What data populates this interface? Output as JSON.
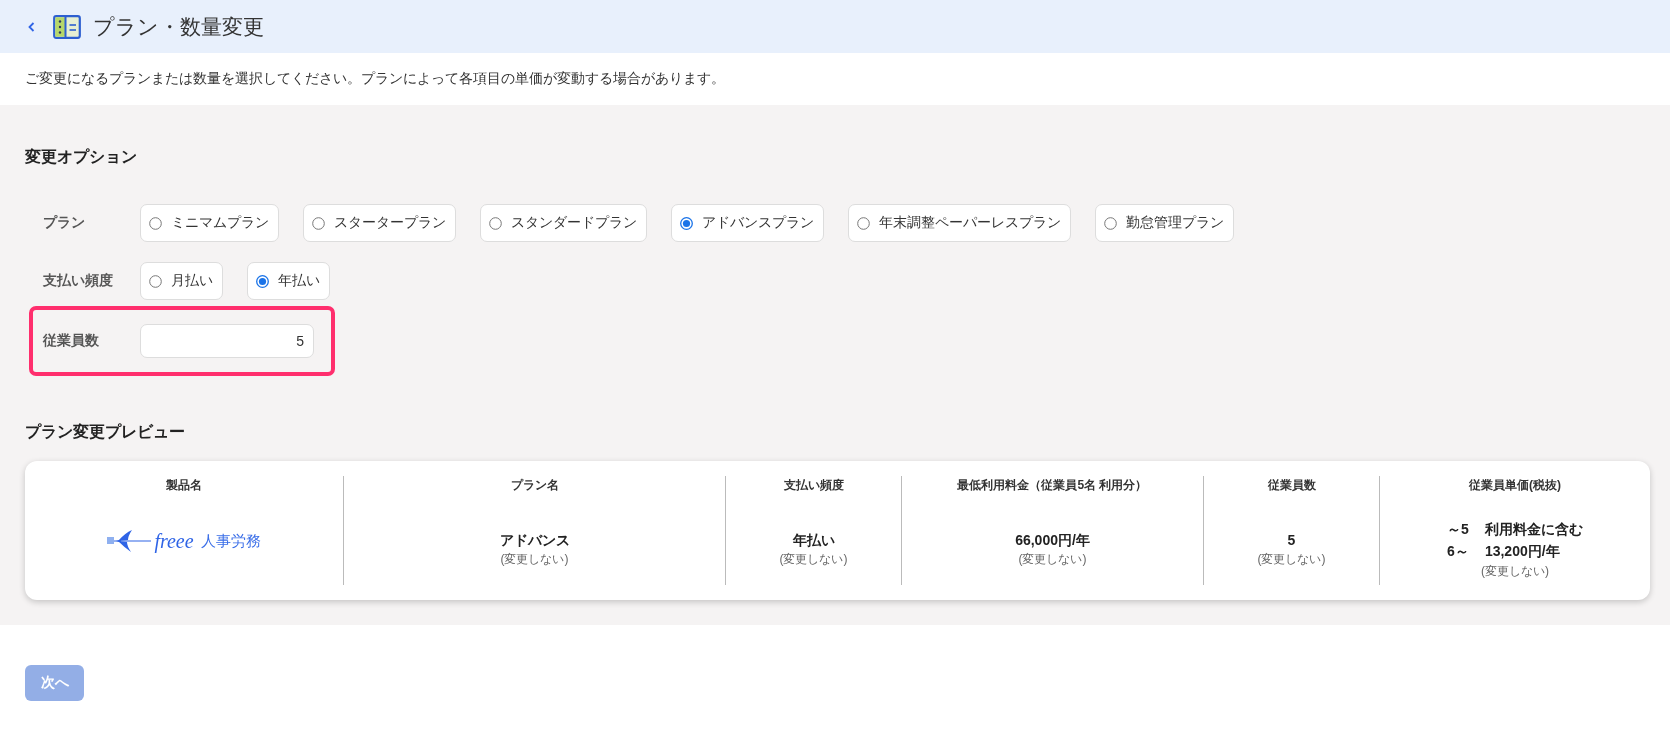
{
  "header": {
    "title": "プラン・数量変更"
  },
  "description": "ご変更になるプランまたは数量を選択してください。プランによって各項目の単価が変動する場合があります。",
  "options": {
    "title": "変更オプション",
    "rows": [
      {
        "kind": "radio",
        "label": "プラン",
        "items": [
          {
            "label": "ミニマムプラン",
            "selected": false
          },
          {
            "label": "スタータープラン",
            "selected": false
          },
          {
            "label": "スタンダードプラン",
            "selected": false
          },
          {
            "label": "アドバンスプラン",
            "selected": true
          },
          {
            "label": "年末調整ペーパーレスプラン",
            "selected": false
          },
          {
            "label": "勤怠管理プラン",
            "selected": false
          }
        ]
      },
      {
        "kind": "radio",
        "label": "支払い頻度",
        "items": [
          {
            "label": "月払い",
            "selected": false
          },
          {
            "label": "年払い",
            "selected": true
          }
        ]
      },
      {
        "kind": "number",
        "label": "従業員数",
        "value": "5",
        "highlighted": true
      }
    ]
  },
  "preview": {
    "title": "プラン変更プレビュー",
    "columns": [
      {
        "kind": "logo",
        "header": "製品名",
        "wordmark": "freee",
        "product": "人事労務"
      },
      {
        "kind": "value",
        "header": "プラン名",
        "value": "アドバンス",
        "note": "(変更しない)"
      },
      {
        "kind": "value",
        "header": "支払い頻度",
        "value": "年払い",
        "note": "(変更しない)"
      },
      {
        "kind": "value",
        "header": "最低利用料金（従業員5名 利用分）",
        "value": "66,000円/年",
        "note": "(変更しない)"
      },
      {
        "kind": "value",
        "header": "従業員数",
        "value": "5",
        "note": "(変更しない)"
      },
      {
        "kind": "tiers",
        "header": "従業員単価(税抜)",
        "tiers": [
          {
            "range": "～5",
            "price": "利用料金に含む"
          },
          {
            "range": "6～",
            "price": "13,200円/年"
          }
        ],
        "note": "(変更しない)"
      }
    ]
  },
  "next_button": {
    "label": "次へ",
    "disabled": true
  }
}
